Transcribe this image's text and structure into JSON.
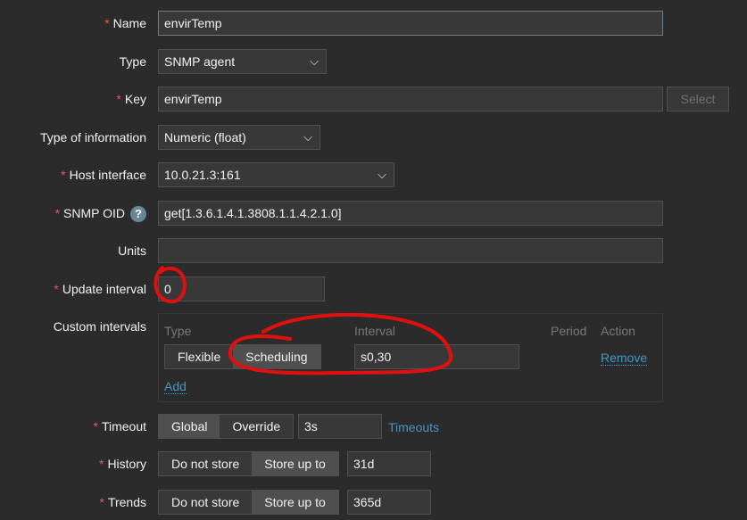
{
  "name": {
    "label": "Name",
    "value": "envirTemp"
  },
  "type": {
    "label": "Type",
    "value": "SNMP agent"
  },
  "key": {
    "label": "Key",
    "value": "envirTemp",
    "select": "Select"
  },
  "type_info": {
    "label": "Type of information",
    "value": "Numeric (float)"
  },
  "host_interface": {
    "label": "Host interface",
    "value": "10.0.21.3:161"
  },
  "snmp_oid": {
    "label": "SNMP OID",
    "help": "?",
    "value": "get[1.3.6.1.4.1.3808.1.1.4.2.1.0]"
  },
  "units": {
    "label": "Units",
    "value": ""
  },
  "update_interval": {
    "label": "Update interval",
    "value": "0"
  },
  "custom_intervals": {
    "label": "Custom intervals",
    "headers": {
      "type": "Type",
      "interval": "Interval",
      "period": "Period",
      "action": "Action"
    },
    "row": {
      "flexible": "Flexible",
      "scheduling": "Scheduling",
      "interval": "s0,30",
      "remove": "Remove"
    },
    "add": "Add"
  },
  "timeout": {
    "label": "Timeout",
    "global": "Global",
    "override": "Override",
    "value": "3s",
    "link": "Timeouts"
  },
  "history": {
    "label": "History",
    "do_not_store": "Do not store",
    "store_up_to": "Store up to",
    "value": "31d"
  },
  "trends": {
    "label": "Trends",
    "do_not_store": "Do not store",
    "store_up_to": "Store up to",
    "value": "365d"
  }
}
